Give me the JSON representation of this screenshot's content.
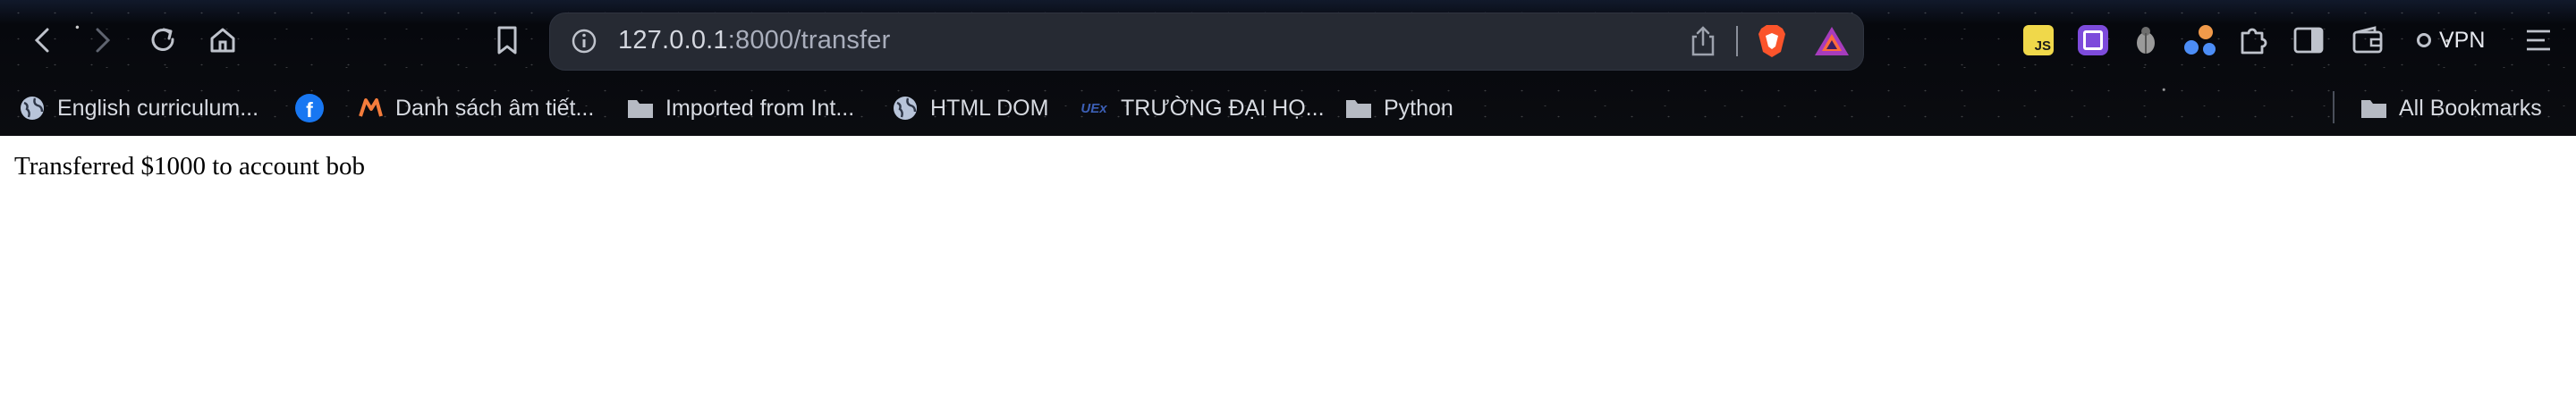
{
  "browser": {
    "address_host": "127.0.0.1",
    "address_path": ":8000/transfer",
    "vpn_label": "VPN",
    "extensions": [
      "js-badge-icon",
      "puzzle-extension-icon",
      "ladybug-icon",
      "dots-icon",
      "extensions-icon",
      "sidebar-icon",
      "wallet-icon"
    ]
  },
  "bookmarks": {
    "items": [
      {
        "label": "English curriculum..."
      },
      {
        "label": ""
      },
      {
        "label": "Danh sách âm tiết..."
      },
      {
        "label": "Imported from Int..."
      },
      {
        "label": "HTML DOM"
      },
      {
        "label": "TRƯỜNG ĐẠI HỌ..."
      },
      {
        "label": "Python"
      }
    ],
    "all_label": "All Bookmarks"
  },
  "page": {
    "message": "Transferred $1000 to account bob"
  }
}
